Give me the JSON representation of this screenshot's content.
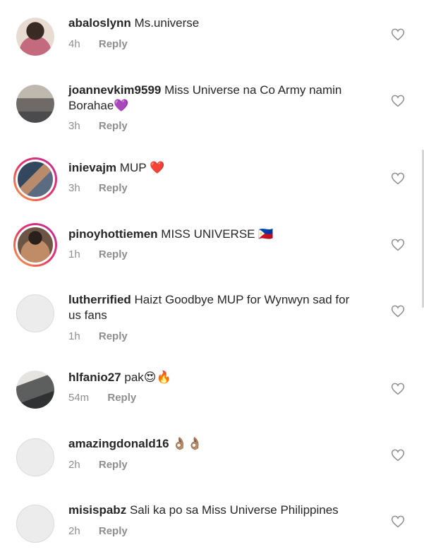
{
  "comments": [
    {
      "username": "abaloslynn",
      "text": "Ms.universe",
      "time": "4h",
      "reply": "Reply",
      "avatar": {
        "type": "photo",
        "color": "#9a7b6c"
      }
    },
    {
      "username": "joannevkim9599",
      "text": "Miss Universe na Co Army namin Borahae💜",
      "time": "3h",
      "reply": "Reply",
      "avatar": {
        "type": "photo",
        "color": "#6f6a68"
      }
    },
    {
      "username": "inievajm",
      "text": "MUP ❤️",
      "time": "3h",
      "reply": "Reply",
      "avatar": {
        "type": "story-ring",
        "color": "#5a6b82"
      }
    },
    {
      "username": "pinoyhottiemen",
      "text": "MISS UNIVERSE 🇵🇭",
      "time": "1h",
      "reply": "Reply",
      "avatar": {
        "type": "story-ring",
        "color": "#8a6a52"
      }
    },
    {
      "username": "lutherrified",
      "text": "Haizt Goodbye MUP for Wynwyn sad for us fans",
      "time": "1h",
      "reply": "Reply",
      "avatar": {
        "type": "blank"
      }
    },
    {
      "username": "hlfanio27",
      "text": "pak😍🔥",
      "time": "54m",
      "reply": "Reply",
      "avatar": {
        "type": "photo",
        "color": "#5d5f5e"
      }
    },
    {
      "username": "amazingdonald16",
      "text": "👌🏽👌🏽",
      "time": "2h",
      "reply": "Reply",
      "avatar": {
        "type": "blank"
      }
    },
    {
      "username": "misispabz",
      "text": "Sali ka po sa Miss Universe Philippines",
      "time": "2h",
      "reply": "Reply",
      "avatar": {
        "type": "blank"
      }
    }
  ],
  "icons": {
    "like": "heart-outline-icon"
  },
  "colors": {
    "text": "#262626",
    "meta": "#8e8e8e",
    "heart": "#8e8e8e"
  }
}
